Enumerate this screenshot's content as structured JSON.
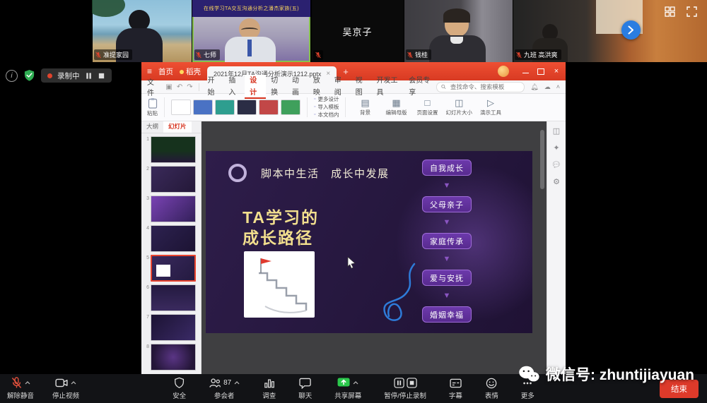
{
  "colors": {
    "wps_red": "#e0432c",
    "share_green": "#2bc84c",
    "end_red": "#dd3a2a",
    "slide_purple": "#2a1a42",
    "flow_border": "#9f6cd8",
    "accent_yellow": "#f2df8e",
    "next_button_blue": "#2a7de1"
  },
  "video_strip": {
    "participants": [
      {
        "name": "准提家园",
        "muted": true
      },
      {
        "name": "七师",
        "muted": true,
        "banner_line1": "在线学习TA交互沟通分析之潘杰家族(五)"
      },
      {
        "name": "吴京子",
        "muted": true
      },
      {
        "name": "钱桂",
        "muted": true
      },
      {
        "name": "九班 高洪爽",
        "muted": true
      }
    ]
  },
  "recording_bar": {
    "label": "录制中"
  },
  "wps": {
    "titlebar": {
      "home": "首页",
      "docer": "稻壳",
      "doc": "2021年12月TA沟通分析演示1212.pptx"
    },
    "menubar": {
      "file": "文件",
      "tabs": [
        "开始",
        "插入",
        "设计",
        "切换",
        "动画",
        "放映",
        "审阅",
        "视图",
        "开发工具",
        "会员专享"
      ],
      "active_tab": "设计",
      "search_placeholder": "查找命令、搜索模板"
    },
    "ribbon": {
      "paste": "粘贴",
      "stack_buttons": [
        "更多设计",
        "导入模板",
        "本文档内"
      ],
      "buttons": [
        "背景",
        "编辑母版",
        "页面设置",
        "幻灯片大小",
        "演示工具"
      ],
      "template_colors": [
        "#ffffff",
        "#4a72c4",
        "#2e9e8f",
        "#2b2d45",
        "#c24747",
        "#3fa05c"
      ]
    },
    "panel": {
      "tabs": [
        "大纲",
        "幻灯片"
      ],
      "active": "幻灯片",
      "slide_count": 8,
      "selected": 5
    },
    "slide": {
      "title": "脚本中生活　成长中发展",
      "left_title_lines": [
        "TA学习的",
        "成长路径"
      ],
      "flow": [
        "自我成长",
        "父母亲子",
        "家庭传承",
        "爱与安抚",
        "婚姻幸福"
      ]
    }
  },
  "toolbar": {
    "items": [
      {
        "label": "解除静音",
        "icon": "mic-muted-icon",
        "chevron": true
      },
      {
        "label": "停止视频",
        "icon": "camera-icon",
        "chevron": true
      },
      {
        "label": "安全",
        "icon": "shield-icon"
      },
      {
        "label": "参会者",
        "icon": "participants-icon",
        "count": "87",
        "chevron": true
      },
      {
        "label": "调查",
        "icon": "poll-icon"
      },
      {
        "label": "聊天",
        "icon": "chat-icon"
      },
      {
        "label": "共享屏幕",
        "icon": "share-screen-icon",
        "chevron": true
      },
      {
        "label": "暂停/停止录制",
        "icon": "record-controls-icon"
      },
      {
        "label": "字幕",
        "icon": "captions-icon"
      },
      {
        "label": "表情",
        "icon": "reactions-icon"
      },
      {
        "label": "更多",
        "icon": "more-icon"
      }
    ],
    "end_label": "结束"
  },
  "watermark": {
    "text": "微信号: zhuntijiayuan"
  }
}
